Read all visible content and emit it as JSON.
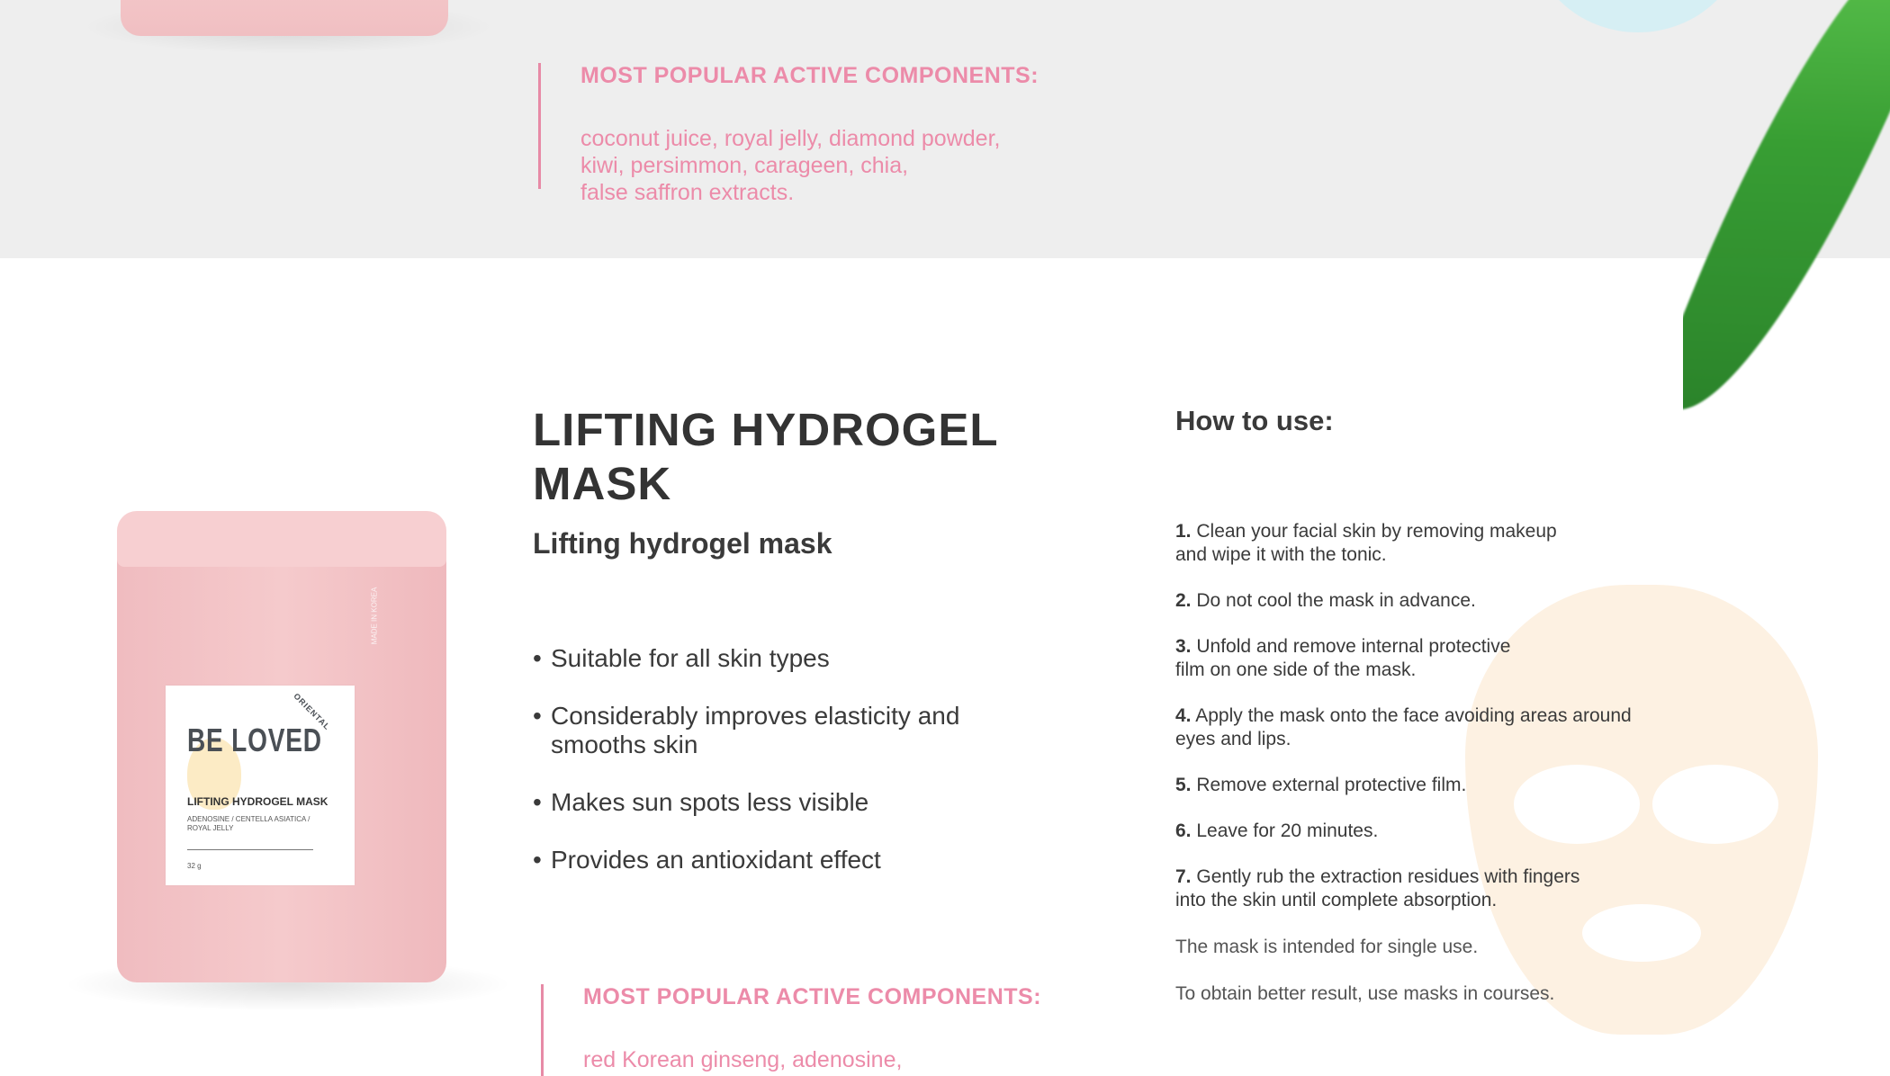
{
  "colors": {
    "accent_pink": "#ec8ba9",
    "band_gray": "#eeeeee",
    "mask_peach": "#fdf1e2",
    "pouch_pink": "#f5cacc"
  },
  "top_section": {
    "components_label": "MOST POPULAR ACTIVE COMPONENTS:",
    "components_list": "coconut juice, royal jelly, diamond powder,\nkiwi, persimmon, carageen, chia,\nfalse saffron extracts."
  },
  "product": {
    "title": "LIFTING HYDROGEL MASK",
    "subtitle": "Lifting hydrogel mask",
    "features": [
      "Suitable for all skin types",
      "Considerably improves elasticity and smooths skin",
      "Makes sun spots less visible",
      "Provides an antioxidant effect"
    ],
    "components_label": "MOST POPULAR ACTIVE COMPONENTS:",
    "components_list": "red Korean ginseng, adenosine,\ncentella asiatica, royal jelly"
  },
  "howto": {
    "title": "How to use:",
    "steps": [
      {
        "num": "1.",
        "text": "Clean your facial skin by removing makeup\nand wipe it with the tonic."
      },
      {
        "num": "2.",
        "text": "Do not cool the mask in advance."
      },
      {
        "num": "3.",
        "text": "Unfold and remove internal protective\nfilm on one side of the mask."
      },
      {
        "num": "4.",
        "text": "Apply the mask onto the face avoiding areas around\neyes and lips."
      },
      {
        "num": "5.",
        "text": "Remove external protective film."
      },
      {
        "num": "6.",
        "text": "Leave for 20 minutes."
      },
      {
        "num": "7.",
        "text": " Gently rub the extraction residues with fingers\ninto the skin until complete absorption."
      }
    ],
    "notes": [
      "The mask is intended for single use.",
      "To obtain better result, use masks in courses."
    ]
  },
  "package": {
    "brand": "BE LOVED",
    "brand_arc": "ORIENTAL",
    "name": "LIFTING HYDROGEL MASK",
    "ingredients": "ADENOSINE / CENTELLA ASIATICA / ROYAL JELLY",
    "weight": "32 g",
    "side_text": "MADE IN KOREA"
  }
}
